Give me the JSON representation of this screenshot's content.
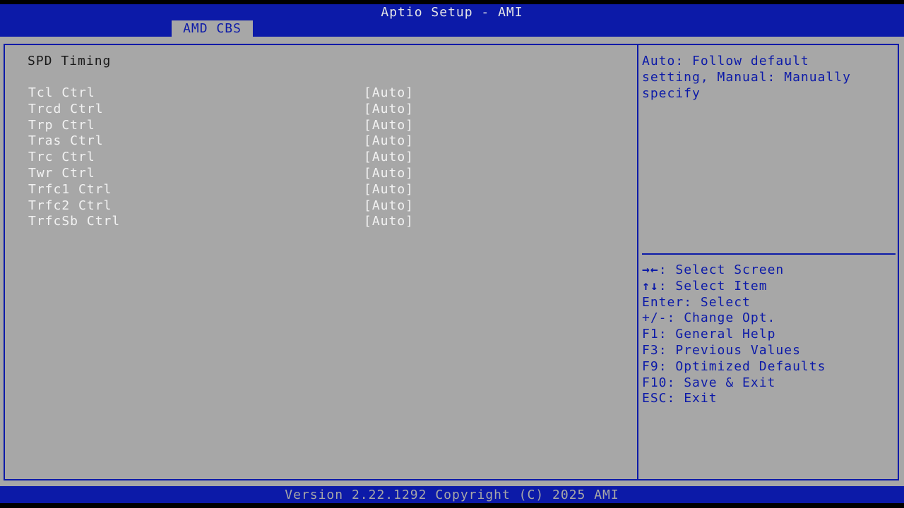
{
  "header": {
    "title": "Aptio Setup - AMI",
    "active_tab": "AMD CBS"
  },
  "page": {
    "title": "SPD Timing"
  },
  "settings": [
    {
      "label": "Tcl Ctrl",
      "value": "[Auto]"
    },
    {
      "label": "Trcd Ctrl",
      "value": "[Auto]"
    },
    {
      "label": "Trp Ctrl",
      "value": "[Auto]"
    },
    {
      "label": "Tras Ctrl",
      "value": "[Auto]"
    },
    {
      "label": "Trc Ctrl",
      "value": "[Auto]"
    },
    {
      "label": "Twr Ctrl",
      "value": "[Auto]"
    },
    {
      "label": "Trfc1 Ctrl",
      "value": "[Auto]"
    },
    {
      "label": "Trfc2 Ctrl",
      "value": "[Auto]"
    },
    {
      "label": "TrfcSb Ctrl",
      "value": "[Auto]"
    }
  ],
  "help": {
    "description": "Auto: Follow default\nsetting, Manual: Manually\nspecify"
  },
  "keys": [
    {
      "key": "→←",
      "action": ": Select Screen"
    },
    {
      "key": "↑↓",
      "action": ": Select Item"
    },
    {
      "key": "Enter",
      "action": ": Select"
    },
    {
      "key": "+/-",
      "action": ": Change Opt."
    },
    {
      "key": "F1",
      "action": ": General Help"
    },
    {
      "key": "F3",
      "action": ": Previous Values"
    },
    {
      "key": "F9",
      "action": ": Optimized Defaults"
    },
    {
      "key": "F10",
      "action": ": Save & Exit"
    },
    {
      "key": "ESC",
      "action": ": Exit"
    }
  ],
  "footer": {
    "text": "Version 2.22.1292 Copyright (C) 2025 AMI"
  },
  "colors": {
    "bios_blue": "#0c1aa8",
    "panel_gray": "#a7a7a7",
    "value_white": "#f2f2f2"
  }
}
